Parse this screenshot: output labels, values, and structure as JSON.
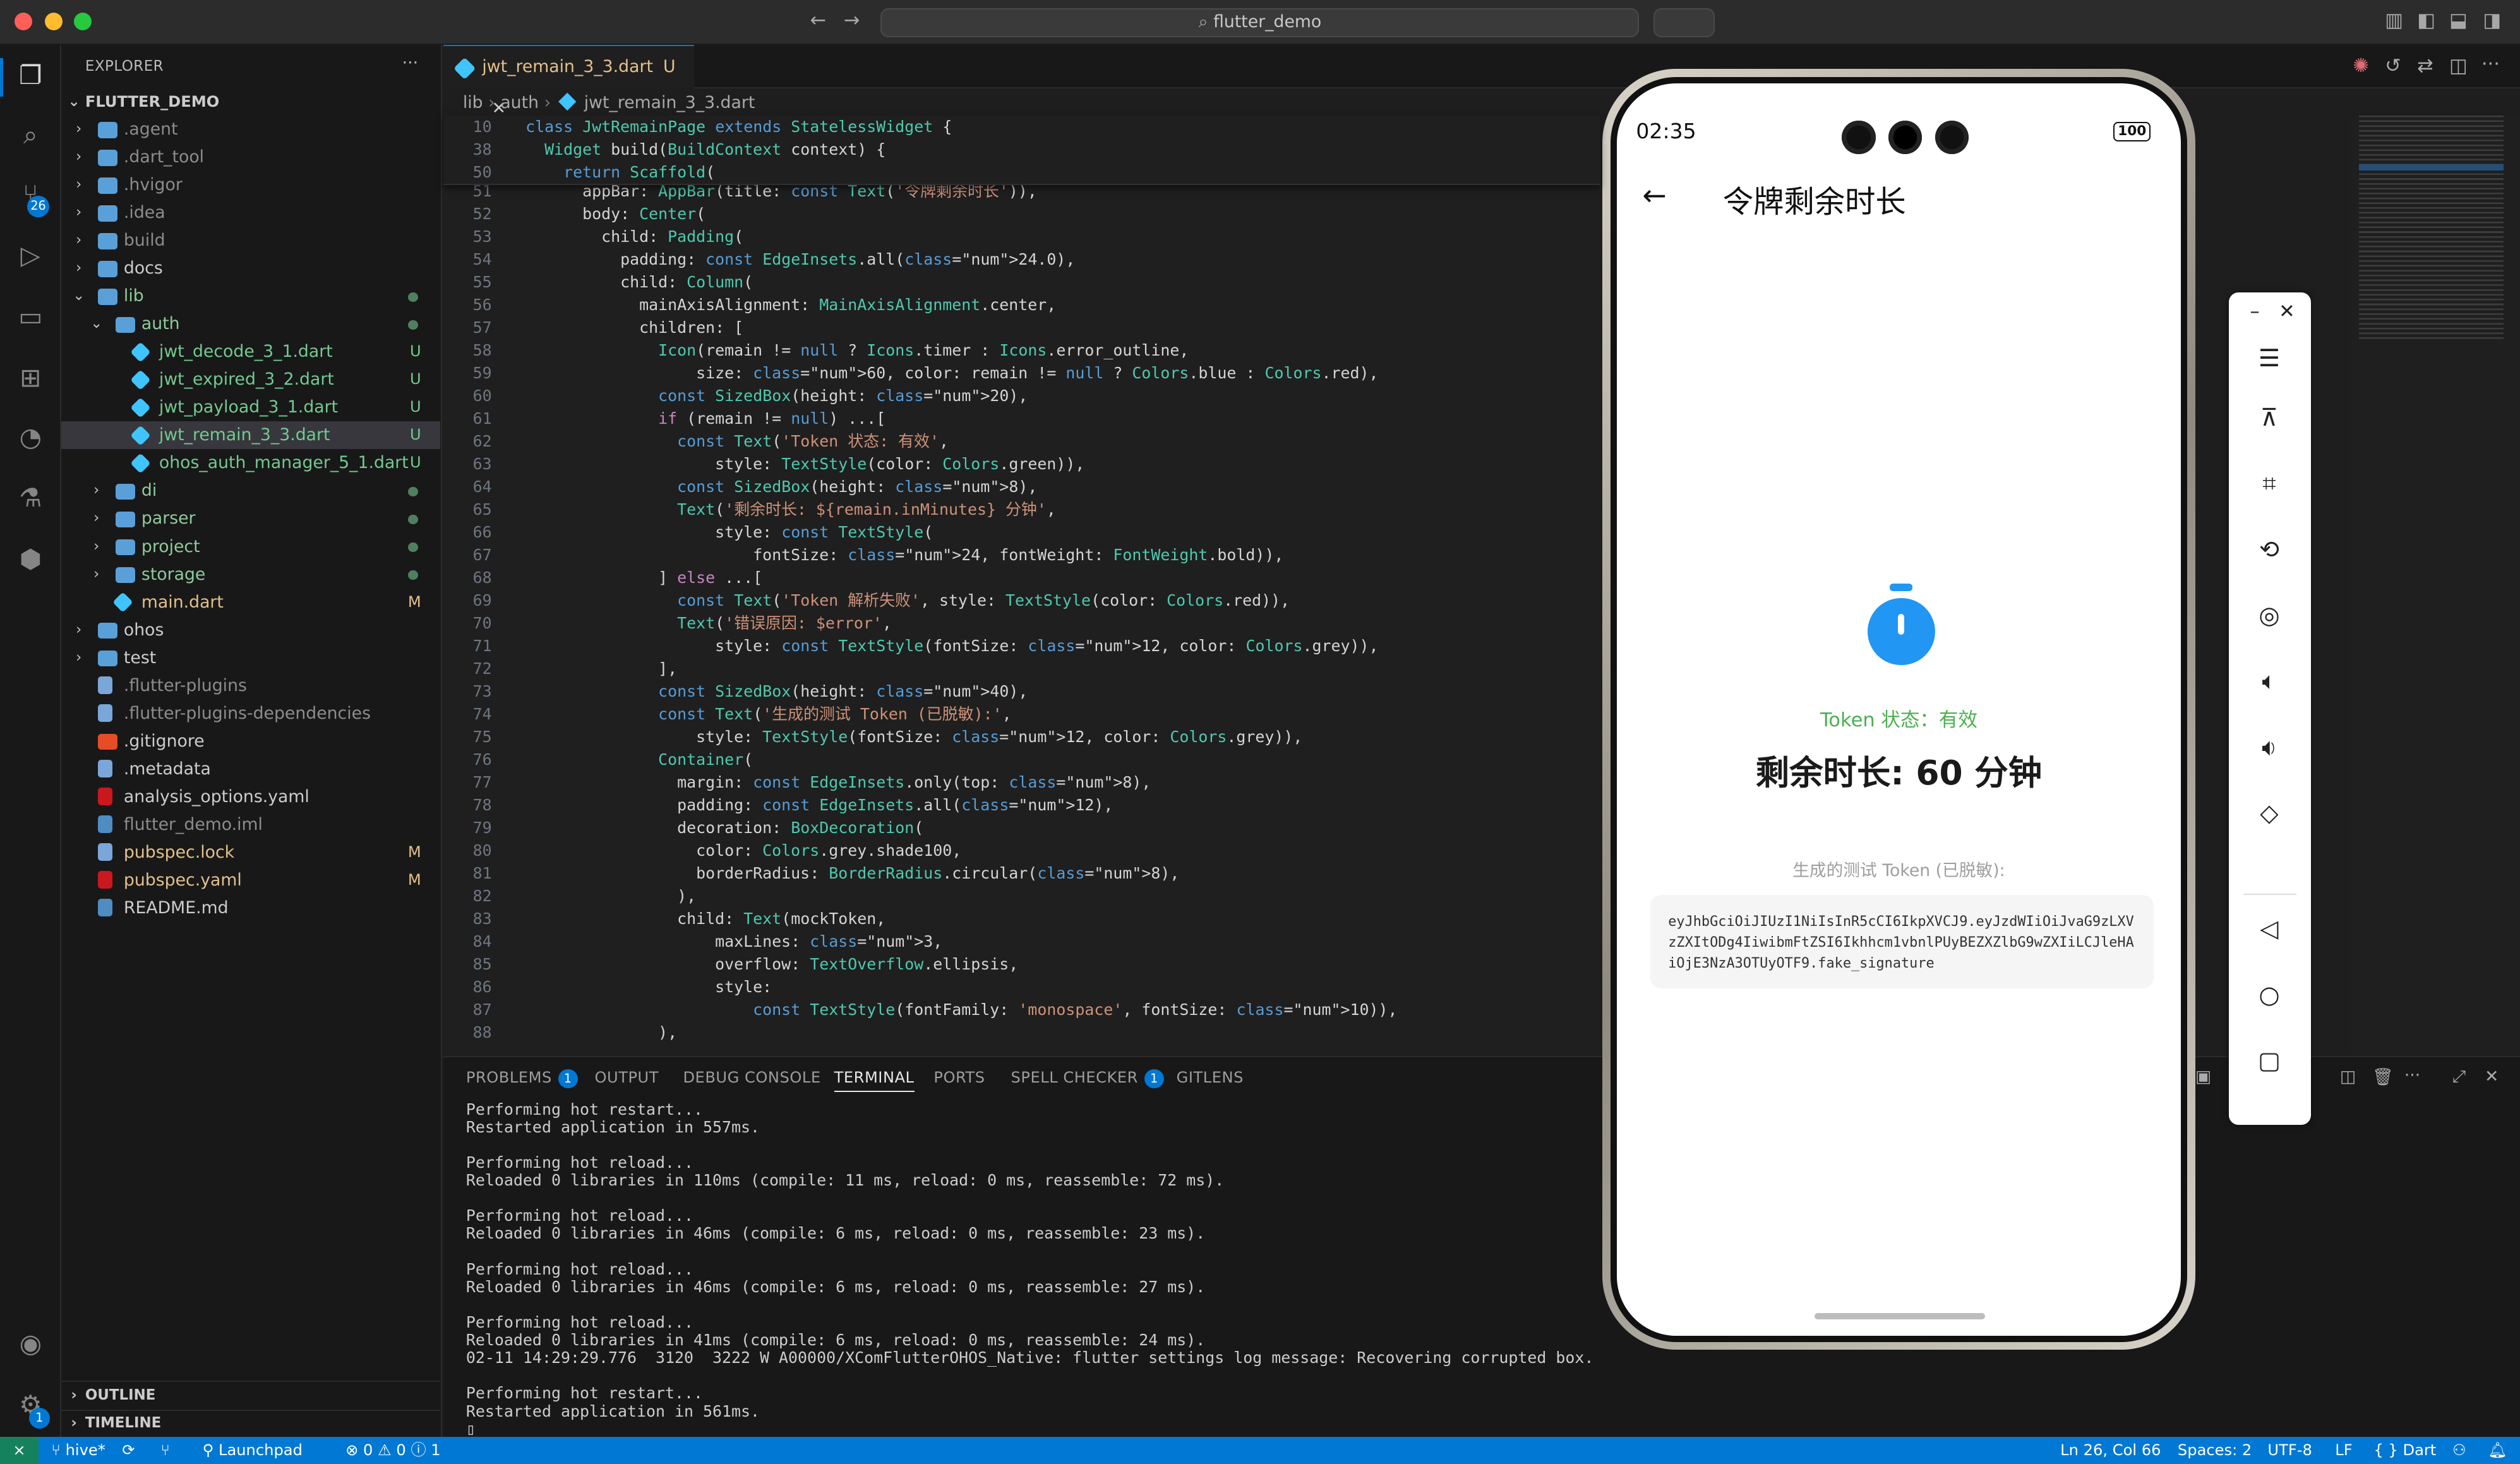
{
  "window": {
    "search_text": "flutter_demo",
    "nav_back": "←",
    "nav_forward": "→"
  },
  "activity": {
    "source_control_badge": "26",
    "settings_badge": "1"
  },
  "sidebar": {
    "title": "EXPLORER",
    "more": "···",
    "project": "FLUTTER_DEMO",
    "items": [
      {
        "name": ".agent",
        "type": "folder",
        "depth": 1,
        "git": ""
      },
      {
        "name": ".dart_tool",
        "type": "folder",
        "depth": 1,
        "git": ""
      },
      {
        "name": ".hvigor",
        "type": "folder",
        "depth": 1,
        "git": ""
      },
      {
        "name": ".idea",
        "type": "folder",
        "depth": 1,
        "git": ""
      },
      {
        "name": "build",
        "type": "folder",
        "depth": 1,
        "git": ""
      },
      {
        "name": "docs",
        "type": "folder",
        "depth": 1,
        "git": ""
      },
      {
        "name": "lib",
        "type": "folder-open",
        "depth": 1,
        "git": "dot"
      },
      {
        "name": "auth",
        "type": "folder-open",
        "depth": 2,
        "git": "dot"
      },
      {
        "name": "jwt_decode_3_1.dart",
        "type": "dart",
        "depth": 3,
        "git": "U"
      },
      {
        "name": "jwt_expired_3_2.dart",
        "type": "dart",
        "depth": 3,
        "git": "U"
      },
      {
        "name": "jwt_payload_3_1.dart",
        "type": "dart",
        "depth": 3,
        "git": "U"
      },
      {
        "name": "jwt_remain_3_3.dart",
        "type": "dart",
        "depth": 3,
        "git": "U"
      },
      {
        "name": "ohos_auth_manager_5_1.dart",
        "type": "dart",
        "depth": 3,
        "git": "U"
      },
      {
        "name": "di",
        "type": "folder",
        "depth": 2,
        "git": "dot"
      },
      {
        "name": "parser",
        "type": "folder",
        "depth": 2,
        "git": "dot"
      },
      {
        "name": "project",
        "type": "folder",
        "depth": 2,
        "git": "dot"
      },
      {
        "name": "storage",
        "type": "folder",
        "depth": 2,
        "git": "dot"
      },
      {
        "name": "main.dart",
        "type": "dart",
        "depth": 2,
        "git": "M"
      },
      {
        "name": "ohos",
        "type": "folder",
        "depth": 1,
        "git": ""
      },
      {
        "name": "test",
        "type": "folder",
        "depth": 1,
        "git": ""
      },
      {
        "name": ".flutter-plugins",
        "type": "file",
        "depth": 1,
        "git": ""
      },
      {
        "name": ".flutter-plugins-dependencies",
        "type": "file",
        "depth": 1,
        "git": ""
      },
      {
        "name": ".gitignore",
        "type": "git",
        "depth": 1,
        "git": ""
      },
      {
        "name": ".metadata",
        "type": "file",
        "depth": 1,
        "git": ""
      },
      {
        "name": "analysis_options.yaml",
        "type": "yaml",
        "depth": 1,
        "git": ""
      },
      {
        "name": "flutter_demo.iml",
        "type": "xml",
        "depth": 1,
        "git": ""
      },
      {
        "name": "pubspec.lock",
        "type": "file",
        "depth": 1,
        "git": "M"
      },
      {
        "name": "pubspec.yaml",
        "type": "yaml",
        "depth": 1,
        "git": "M"
      },
      {
        "name": "README.md",
        "type": "md",
        "depth": 1,
        "git": ""
      }
    ],
    "outline": "OUTLINE",
    "timeline": "TIMELINE"
  },
  "editor": {
    "tab_label": "jwt_remain_3_3.dart",
    "tab_status": "U",
    "breadcrumb": [
      "lib",
      "auth",
      "jwt_remain_3_3.dart"
    ],
    "sticky": [
      {
        "n": "10",
        "t": "class JwtRemainPage extends StatelessWidget {"
      },
      {
        "n": "38",
        "t": "  Widget build(BuildContext context) {"
      },
      {
        "n": "50",
        "t": "    return Scaffold("
      }
    ],
    "lines": [
      {
        "n": "51",
        "t": "      appBar: AppBar(title: const Text('令牌剩余时长')),"
      },
      {
        "n": "52",
        "t": "      body: Center("
      },
      {
        "n": "53",
        "t": "        child: Padding("
      },
      {
        "n": "54",
        "t": "          padding: const EdgeInsets.all(24.0),"
      },
      {
        "n": "55",
        "t": "          child: Column("
      },
      {
        "n": "56",
        "t": "            mainAxisAlignment: MainAxisAlignment.center,"
      },
      {
        "n": "57",
        "t": "            children: ["
      },
      {
        "n": "58",
        "t": "              Icon(remain != null ? Icons.timer : Icons.error_outline,"
      },
      {
        "n": "59",
        "t": "                  size: 60, color: remain != null ? Colors.blue : Colors.red),"
      },
      {
        "n": "60",
        "t": "              const SizedBox(height: 20),"
      },
      {
        "n": "61",
        "t": "              if (remain != null) ...["
      },
      {
        "n": "62",
        "t": "                const Text('Token 状态: 有效',"
      },
      {
        "n": "63",
        "t": "                    style: TextStyle(color: Colors.green)),"
      },
      {
        "n": "64",
        "t": "                const SizedBox(height: 8),"
      },
      {
        "n": "65",
        "t": "                Text('剩余时长: ${remain.inMinutes} 分钟',"
      },
      {
        "n": "66",
        "t": "                    style: const TextStyle("
      },
      {
        "n": "67",
        "t": "                        fontSize: 24, fontWeight: FontWeight.bold)),"
      },
      {
        "n": "68",
        "t": "              ] else ...["
      },
      {
        "n": "69",
        "t": "                const Text('Token 解析失败', style: TextStyle(color: Colors.red)),"
      },
      {
        "n": "70",
        "t": "                Text('错误原因: $error',"
      },
      {
        "n": "71",
        "t": "                    style: const TextStyle(fontSize: 12, color: Colors.grey)),"
      },
      {
        "n": "72",
        "t": "              ],"
      },
      {
        "n": "73",
        "t": "              const SizedBox(height: 40),"
      },
      {
        "n": "74",
        "t": "              const Text('生成的测试 Token (已脱敏):',"
      },
      {
        "n": "75",
        "t": "                  style: TextStyle(fontSize: 12, color: Colors.grey)),"
      },
      {
        "n": "76",
        "t": "              Container("
      },
      {
        "n": "77",
        "t": "                margin: const EdgeInsets.only(top: 8),"
      },
      {
        "n": "78",
        "t": "                padding: const EdgeInsets.all(12),"
      },
      {
        "n": "79",
        "t": "                decoration: BoxDecoration("
      },
      {
        "n": "80",
        "t": "                  color: Colors.grey.shade100,"
      },
      {
        "n": "81",
        "t": "                  borderRadius: BorderRadius.circular(8),"
      },
      {
        "n": "82",
        "t": "                ),"
      },
      {
        "n": "83",
        "t": "                child: Text(mockToken,"
      },
      {
        "n": "84",
        "t": "                    maxLines: 3,"
      },
      {
        "n": "85",
        "t": "                    overflow: TextOverflow.ellipsis,"
      },
      {
        "n": "86",
        "t": "                    style:"
      },
      {
        "n": "87",
        "t": "                        const TextStyle(fontFamily: 'monospace', fontSize: 10)),"
      },
      {
        "n": "88",
        "t": "              ),"
      }
    ]
  },
  "panel": {
    "tabs": [
      {
        "label": "PROBLEMS",
        "badge": "1"
      },
      {
        "label": "OUTPUT",
        "badge": ""
      },
      {
        "label": "DEBUG CONSOLE",
        "badge": ""
      },
      {
        "label": "TERMINAL",
        "badge": ""
      },
      {
        "label": "PORTS",
        "badge": ""
      },
      {
        "label": "SPELL CHECKER",
        "badge": "1"
      },
      {
        "label": "GITLENS",
        "badge": ""
      }
    ],
    "terminal_lines": [
      "Performing hot restart...",
      "Restarted application in 557ms.",
      "",
      "Performing hot reload...",
      "Reloaded 0 libraries in 110ms (compile: 11 ms, reload: 0 ms, reassemble: 72 ms).",
      "",
      "Performing hot reload...",
      "Reloaded 0 libraries in 46ms (compile: 6 ms, reload: 0 ms, reassemble: 23 ms).",
      "",
      "Performing hot reload...",
      "Reloaded 0 libraries in 46ms (compile: 6 ms, reload: 0 ms, reassemble: 27 ms).",
      "",
      "Performing hot reload...",
      "Reloaded 0 libraries in 41ms (compile: 6 ms, reload: 0 ms, reassemble: 24 ms).",
      "02-11 14:29:29.776  3120  3222 W A00000/XComFlutterOHOS_Native: flutter settings log message: Recovering corrupted box.",
      "",
      "Performing hot restart...",
      "Restarted application in 561ms."
    ],
    "cursor": "▯"
  },
  "status": {
    "branch": "hive*",
    "launchpad": "Launchpad",
    "errors": "0",
    "warnings": "0",
    "info": "1",
    "position": "Ln 26, Col 66",
    "spaces": "Spaces: 2",
    "encoding": "UTF-8",
    "eol": "LF",
    "language": "Dart"
  },
  "phone": {
    "time": "02:35",
    "battery": "100",
    "app_title": "令牌剩余时长",
    "back": "←",
    "status_text": "Token 状态：有效",
    "remain_text": "剩余时长: 60 分钟",
    "token_label": "生成的测试 Token (已脱敏):",
    "token_value": "eyJhbGciOiJIUzI1NiIsInR5cCI6IkpXVCJ9.eyJzdWIiOiJvaG9zLXVzZXItODg4IiwibmFtZSI6Ikhhcm1vbnlPUyBEZXZlbG9wZXIiLCJleHAiOjE3NzA3OTUyOTF9.fake_signature",
    "colors": {
      "valid": "#4caf50",
      "timer": "#2196f3"
    }
  }
}
